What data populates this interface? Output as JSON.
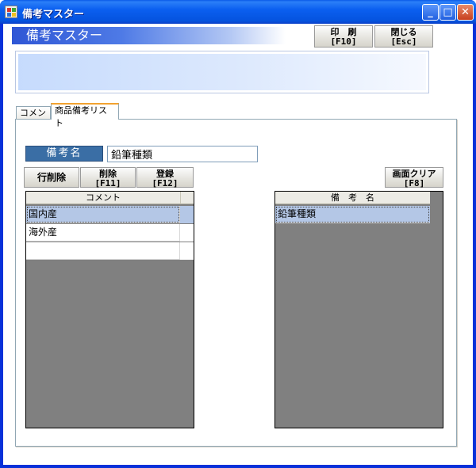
{
  "window": {
    "title": "備考マスター",
    "minimize_glyph": "_",
    "maximize_glyph": "□",
    "close_glyph": "✕",
    "icon": "app-grid-icon"
  },
  "header": {
    "title": "備考マスター",
    "print_button": {
      "line1": "印　刷",
      "line2": "[F10]"
    },
    "close_button": {
      "line1": "閉じる",
      "line2": "[Esc]"
    }
  },
  "tabs": [
    {
      "label": "コメント",
      "active": false
    },
    {
      "label": "商品備考リスト",
      "active": true
    }
  ],
  "form": {
    "remark_name_label": "備考名",
    "remark_name_value": "鉛筆種類"
  },
  "actions": {
    "delete_row": {
      "line1": "行削除"
    },
    "delete": {
      "line1": "削除",
      "line2": "[F11]"
    },
    "register": {
      "line1": "登録",
      "line2": "[F12]"
    },
    "clear_screen": {
      "line1": "画面クリア",
      "line2": "[F8]"
    }
  },
  "comment_grid": {
    "header": "コメント",
    "rows": [
      "国内産",
      "海外産",
      ""
    ]
  },
  "remark_grid": {
    "header": "備　考　名",
    "rows": [
      "鉛筆種類"
    ]
  },
  "colors": {
    "titlebar": "#0b5ff0",
    "label_bg": "#3a6ea5",
    "selected_row": "#b4c7e6",
    "grid_empty": "#808080",
    "active_tab_accent": "#f2a230"
  }
}
